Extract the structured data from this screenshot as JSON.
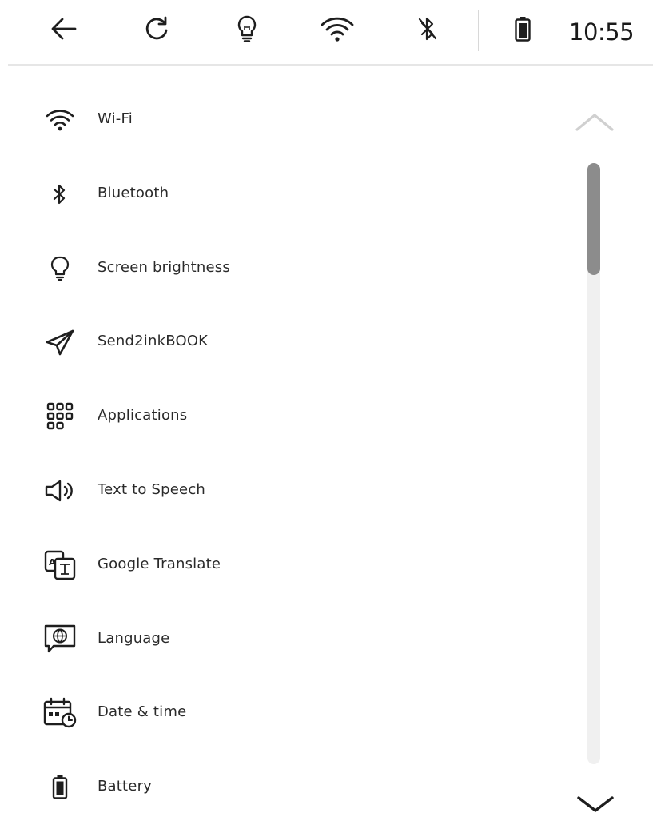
{
  "status_bar": {
    "back_icon": "arrow-left-icon",
    "refresh_icon": "refresh-icon",
    "brightness_icon": "lightbulb-icon",
    "wifi_icon": "wifi-icon",
    "bluetooth_icon": "bluetooth-off-icon",
    "battery_icon": "battery-icon",
    "time": "10:55"
  },
  "settings": {
    "items": [
      {
        "label": "Wi-Fi",
        "icon": "wifi-icon"
      },
      {
        "label": "Bluetooth",
        "icon": "bluetooth-icon"
      },
      {
        "label": "Screen brightness",
        "icon": "lightbulb-icon"
      },
      {
        "label": "Send2inkBOOK",
        "icon": "send-icon"
      },
      {
        "label": "Applications",
        "icon": "apps-grid-icon"
      },
      {
        "label": "Text to Speech",
        "icon": "speaker-icon"
      },
      {
        "label": "Google Translate",
        "icon": "translate-icon"
      },
      {
        "label": "Language",
        "icon": "globe-icon"
      },
      {
        "label": "Date & time",
        "icon": "calendar-clock-icon"
      },
      {
        "label": "Battery",
        "icon": "battery-icon"
      }
    ]
  },
  "scroll": {
    "up_icon": "chevron-up-icon",
    "down_icon": "chevron-down-icon",
    "position_fraction": 0.0
  },
  "colors": {
    "text": "#2a2a2a",
    "icon": "#1e1e1e",
    "divider": "#e6e6e6",
    "scroll_thumb": "#8c8c8c",
    "scroll_track": "#f0f0f0",
    "disabled_chevron": "#d0d0d0"
  }
}
